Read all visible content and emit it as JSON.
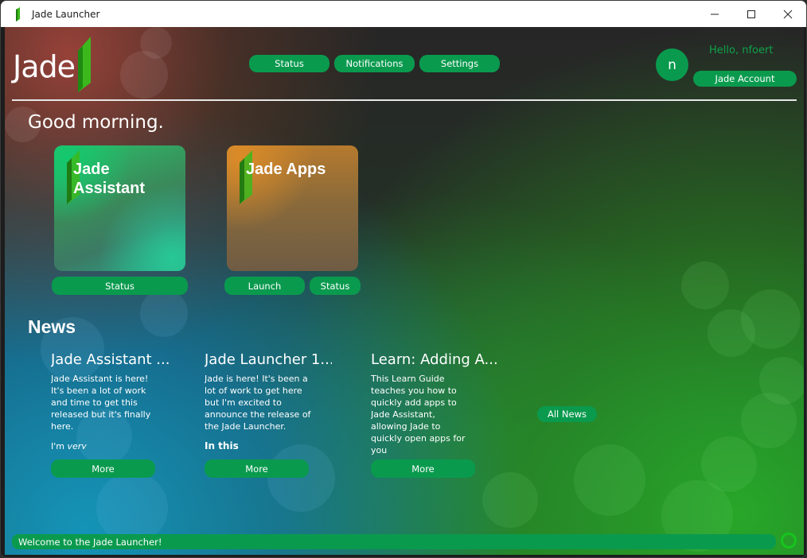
{
  "window": {
    "title": "Jade Launcher",
    "icon": "jade-leaf-icon"
  },
  "brand": {
    "logo_text": "Jade",
    "accent": "#0a9a4e",
    "leaf_color": "#3cb81d"
  },
  "nav": {
    "status": "Status",
    "notifications": "Notifications",
    "settings": "Settings"
  },
  "user": {
    "avatar_initial": "n",
    "greeting": "Hello, nfoert",
    "account_button": "Jade Account"
  },
  "greeting": "Good morning.",
  "apps": [
    {
      "name": "Jade Assistant",
      "buttons": [
        "Status"
      ]
    },
    {
      "name": "Jade Apps",
      "buttons": [
        "Launch",
        "Status"
      ]
    }
  ],
  "news": {
    "heading": "News",
    "all_button": "All News",
    "items": [
      {
        "title": "Jade Assistant ...",
        "body1": "Jade Assistant is here! It's been a lot of work and time to get this released but it's finally here.",
        "body2_prefix": "I'm ",
        "body2_em": "very",
        "more": "More"
      },
      {
        "title": "Jade Launcher 1...",
        "body1": "Jade is here! It's been a lot of work to get here but I'm excited to announce the release of the Jade Launcher.",
        "body2": "In this",
        "more": "More"
      },
      {
        "title": "Learn: Adding A...",
        "body1": "This Learn Guide teaches you how to quickly add apps to Jade Assistant, allowing Jade to quickly open apps for you",
        "more": "More"
      }
    ]
  },
  "status_bar": {
    "message": "Welcome to the Jade Launcher!"
  }
}
